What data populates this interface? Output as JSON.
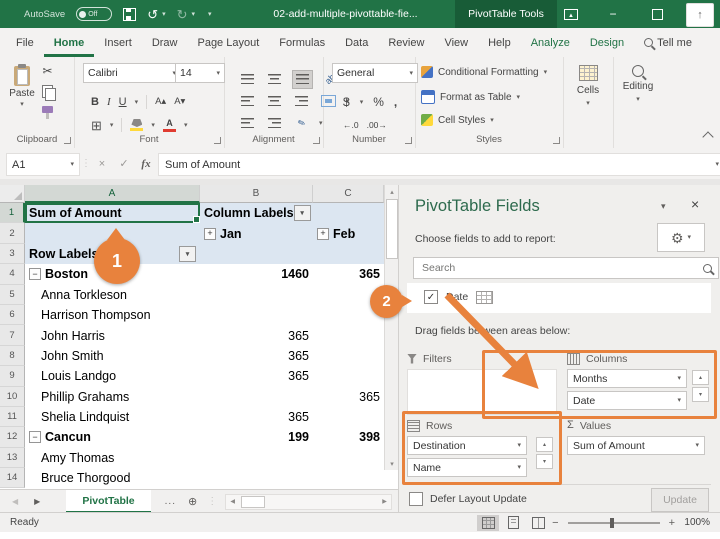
{
  "titlebar": {
    "autosave_label": "AutoSave",
    "autosave_state": "Off",
    "document_title": "02-add-multiple-pivottable-fie...",
    "contextual_tab": "PivotTable Tools"
  },
  "ribbon_tabs": [
    {
      "label": "File"
    },
    {
      "label": "Home",
      "active": true
    },
    {
      "label": "Insert"
    },
    {
      "label": "Draw"
    },
    {
      "label": "Page Layout"
    },
    {
      "label": "Formulas"
    },
    {
      "label": "Data"
    },
    {
      "label": "Review"
    },
    {
      "label": "View"
    },
    {
      "label": "Help"
    },
    {
      "label": "Analyze",
      "contextual": true
    },
    {
      "label": "Design",
      "contextual": true
    },
    {
      "label": "Tell me",
      "search_icon": true
    }
  ],
  "ribbon": {
    "groups": {
      "clipboard": "Clipboard",
      "font": "Font",
      "alignment": "Alignment",
      "number": "Number",
      "styles": "Styles"
    },
    "paste_label": "Paste",
    "font_name": "Calibri",
    "font_size": "14",
    "bold_label": "B",
    "italic_label": "I",
    "underline_label": "U",
    "number_format": "General",
    "currency_label": "$",
    "percent_label": "%",
    "comma_label": ",",
    "inc_decimal_label": "←.0",
    "dec_decimal_label": ".00→",
    "styles_buttons": [
      "Conditional Formatting",
      "Format as Table",
      "Cell Styles"
    ],
    "cells_label": "Cells",
    "editing_label": "Editing"
  },
  "formula_bar": {
    "name_box": "A1",
    "cancel_label": "×",
    "enter_label": "✓",
    "fx_label": "fx",
    "content": "Sum of Amount"
  },
  "grid": {
    "columns": [
      "A",
      "B",
      "C"
    ],
    "rows": [
      {
        "n": 1,
        "band": true,
        "cells": {
          "a": {
            "t": "Sum of Amount",
            "bold": true,
            "selected": true
          },
          "b": {
            "t": "Column Labels",
            "bold": true,
            "filter": true
          }
        }
      },
      {
        "n": 2,
        "band": true,
        "cells": {
          "b": {
            "t": "Jan",
            "bold": true,
            "plus": true
          },
          "c": {
            "t": "Feb",
            "bold": true,
            "plus": true
          }
        }
      },
      {
        "n": 3,
        "band": true,
        "cells": {
          "a": {
            "t": "Row Labels",
            "bold": true,
            "filter": true
          }
        }
      },
      {
        "n": 4,
        "cells": {
          "a": {
            "t": "Boston",
            "bold": true,
            "minus": true
          },
          "b": {
            "t": "1460",
            "bold": true,
            "align": "right"
          },
          "c": {
            "t": "365",
            "bold": true,
            "align": "right"
          }
        }
      },
      {
        "n": 5,
        "cells": {
          "a": {
            "t": "Anna Torkleson",
            "indent": true
          }
        }
      },
      {
        "n": 6,
        "cells": {
          "a": {
            "t": "Harrison Thompson",
            "indent": true
          }
        }
      },
      {
        "n": 7,
        "cells": {
          "a": {
            "t": "John Harris",
            "indent": true
          },
          "b": {
            "t": "365",
            "align": "right"
          }
        }
      },
      {
        "n": 8,
        "cells": {
          "a": {
            "t": "John Smith",
            "indent": true
          },
          "b": {
            "t": "365",
            "align": "right"
          }
        }
      },
      {
        "n": 9,
        "cells": {
          "a": {
            "t": "Louis Landgo",
            "indent": true
          },
          "b": {
            "t": "365",
            "align": "right"
          }
        }
      },
      {
        "n": 10,
        "cells": {
          "a": {
            "t": "Phillip Grahams",
            "indent": true
          },
          "c": {
            "t": "365",
            "align": "right"
          }
        }
      },
      {
        "n": 11,
        "cells": {
          "a": {
            "t": "Shelia Lindquist",
            "indent": true
          },
          "b": {
            "t": "365",
            "align": "right"
          }
        }
      },
      {
        "n": 12,
        "cells": {
          "a": {
            "t": "Cancun",
            "bold": true,
            "minus": true
          },
          "b": {
            "t": "199",
            "bold": true,
            "align": "right"
          },
          "c": {
            "t": "398",
            "bold": true,
            "align": "right"
          }
        }
      },
      {
        "n": 13,
        "cells": {
          "a": {
            "t": "Amy Thomas",
            "indent": true
          }
        }
      },
      {
        "n": 14,
        "cells": {
          "a": {
            "t": "Bruce Thorgood",
            "indent": true
          }
        }
      }
    ]
  },
  "pane": {
    "title": "PivotTable Fields",
    "choose_label": "Choose fields to add to report:",
    "search_placeholder": "Search",
    "fields": [
      {
        "label": "Date",
        "checked": true
      }
    ],
    "drag_label": "Drag fields between areas below:",
    "areas": {
      "filters": {
        "label": "Filters",
        "items": []
      },
      "columns": {
        "label": "Columns",
        "items": [
          "Months",
          "Date"
        ]
      },
      "rows": {
        "label": "Rows",
        "items": [
          "Destination",
          "Name"
        ]
      },
      "values": {
        "label": "Values",
        "items": [
          "Sum of Amount"
        ]
      }
    },
    "defer_label": "Defer Layout Update",
    "update_label": "Update"
  },
  "sheet_tabs": {
    "active": "PivotTable",
    "overflow": "..."
  },
  "status_bar": {
    "ready_label": "Ready",
    "zoom_level": "100%"
  },
  "annotations": {
    "step1_label": "1",
    "step2_label": "2"
  },
  "icons": {
    "gear": "⚙",
    "undo": "↺",
    "redo": "↻",
    "cut": "✂",
    "dropdown": "▾",
    "spin_up": "▴",
    "spin_down": "▾",
    "close": "×",
    "minimize": "−",
    "add_sheet": "⊕",
    "sigma": "Σ",
    "borders": "⊞",
    "tab_prev": "◀",
    "tab_next": "▶",
    "overflow_dots": "⋮",
    "check": "✓",
    "expand_plus": "+",
    "collapse_minus": "−",
    "font_grow": "A▴",
    "font_shrink": "A▾",
    "share": "↑"
  },
  "colors": {
    "excel_green": "#217346",
    "annotation_orange": "#E8823D",
    "pivot_band_blue": "#DCE6F1"
  }
}
